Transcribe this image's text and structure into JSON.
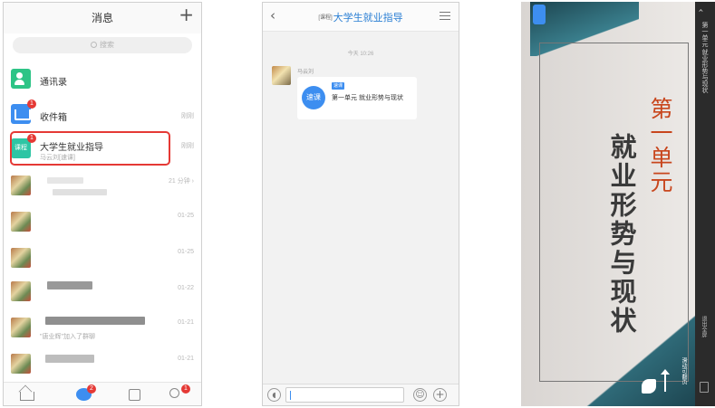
{
  "screen1": {
    "title": "消息",
    "plus_icon": "plus-icon",
    "search_placeholder": "搜索",
    "contacts_label": "通讯录",
    "inbox": {
      "label": "收件箱",
      "time": "刚刚",
      "badge": "1"
    },
    "course": {
      "icon_text": "课程",
      "title": "大学生就业指导",
      "subtitle": "马云刘[速课]",
      "time": "刚刚",
      "badge": "1"
    },
    "chats": [
      {
        "time": "21 分钟 ›"
      },
      {
        "time": "01-25"
      },
      {
        "time": "01-25"
      },
      {
        "time": "01-22"
      },
      {
        "time": "01-21",
        "snippet": "\"唐业辉\"加入了群聊"
      },
      {
        "time": "01-21"
      }
    ],
    "tab_badges": {
      "messages": "2",
      "me": "1"
    }
  },
  "screen2": {
    "title_tag": "[课程]",
    "title": "大学生就业指导",
    "timestamp": "今天 10:26",
    "sender": "马云刘",
    "card_icon_text": "速课",
    "card_tag": "速课",
    "card_text": "第一单元 就业形势与现状"
  },
  "screen3": {
    "unit_title": "第一单元",
    "main_title": "就业形势与现状",
    "rotate_hint": "滑动可翻页",
    "side_title": "第一单元 就业形势与现状",
    "side_link": "退出全屏"
  },
  "colors": {
    "accent_blue": "#3d8ef0",
    "badge_red": "#e53935",
    "teal": "#2f6a78",
    "title_blue": "#2a7fd4"
  }
}
